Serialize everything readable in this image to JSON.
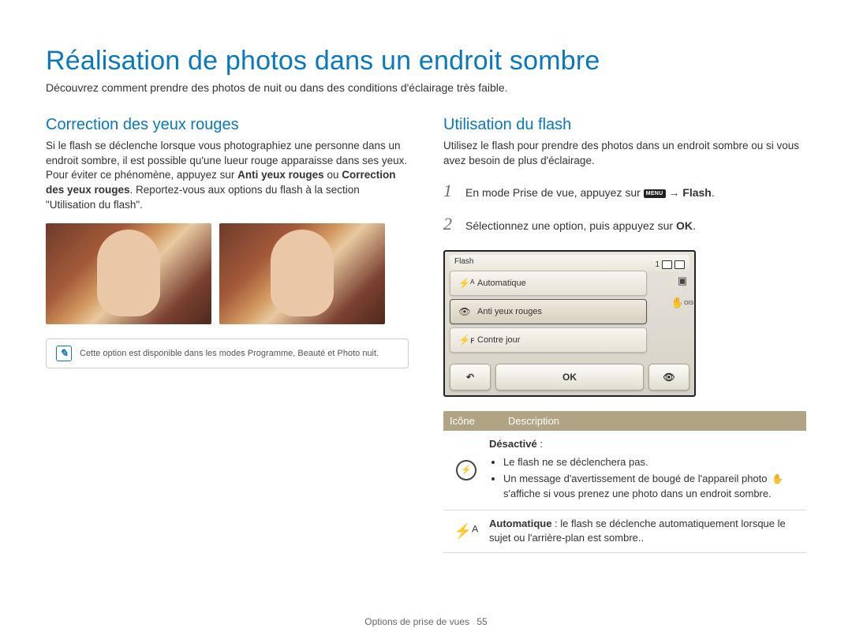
{
  "page_title": "Réalisation de photos dans un endroit sombre",
  "subtitle": "Découvrez comment prendre des photos de nuit ou dans des conditions d'éclairage très faible.",
  "left": {
    "heading": "Correction des yeux rouges",
    "para_before": "Si le flash se déclenche lorsque vous photographiez une personne dans un endroit sombre, il est possible qu'une lueur rouge apparaisse dans ses yeux. Pour éviter ce phénomène, appuyez sur ",
    "bold1": "Anti yeux rouges",
    "mid": " ou ",
    "bold2": "Correction des yeux rouges",
    "para_after": ". Reportez-vous aux options du flash à la section \"Utilisation du flash\".",
    "note": "Cette option est disponible dans les modes Programme, Beauté et Photo nuit."
  },
  "right": {
    "heading": "Utilisation du flash",
    "intro": "Utilisez le flash pour prendre des photos dans un endroit sombre ou si vous avez besoin de plus d'éclairage.",
    "step1_before": "En mode Prise de vue, appuyez sur ",
    "menu_icon_text": "MENU",
    "step1_after": " → ",
    "step1_bold": "Flash",
    "step1_period": ".",
    "step2_before": "Sélectionnez une option, puis appuyez sur ",
    "ok_text": "OK",
    "step2_after": "."
  },
  "lcd": {
    "header_left": "Flash",
    "header_count": "1",
    "rows": [
      {
        "icon": "⚡ᴬ",
        "label": "Automatique"
      },
      {
        "icon": "👁",
        "label": "Anti yeux rouges"
      },
      {
        "icon": "⚡ꜰ",
        "label": "Contre jour"
      }
    ],
    "back_icon": "↶",
    "ok_label": "OK",
    "eye_icon": "👁"
  },
  "table": {
    "h1": "Icône",
    "h2": "Description",
    "row1": {
      "icon": "🚫",
      "title": "Désactivé",
      "colon": " :",
      "b1": "Le flash ne se déclenchera pas.",
      "b2_before": "Un message d'avertissement de bougé de l'appareil photo ",
      "b2_hand": "✋",
      "b2_after": " s'affiche si vous prenez une photo dans un endroit sombre."
    },
    "row2": {
      "icon": "⚡ᴬ",
      "title": "Automatique",
      "desc": " : le flash se déclenche automatiquement lorsque le sujet ou l'arrière-plan est sombre.."
    }
  },
  "footer": {
    "section": "Options de prise de vues",
    "page": "55"
  }
}
